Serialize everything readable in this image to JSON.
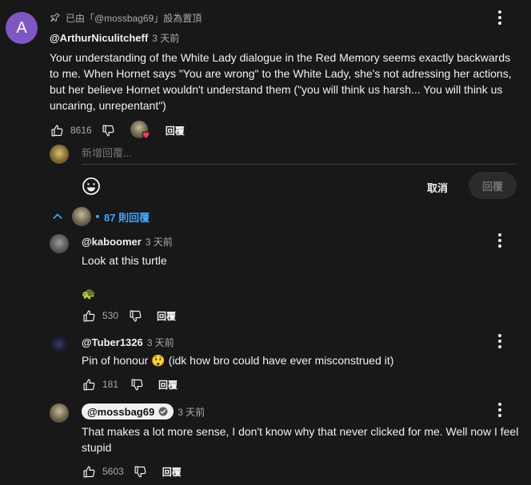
{
  "top_comment": {
    "avatar_letter": "A",
    "pinned_text": "已由「@mossbag69」設為置頂",
    "author": "@ArthurNiculitcheff",
    "time": "3 天前",
    "text": "Your understanding of the White Lady dialogue in the Red Memory seems exactly backwards to me. When Hornet says \"You are wrong\" to the White Lady, she's not adressing her actions, but her believe Hornet wouldn't understand them (\"you will think us harsh... You will think us uncaring, unrepentant\")",
    "likes": "8616",
    "reply_label": "回覆"
  },
  "reply_box": {
    "placeholder": "新增回覆...",
    "cancel_label": "取消",
    "submit_label": "回覆"
  },
  "replies_toggle": {
    "label": "87 則回覆"
  },
  "replies": [
    {
      "author": "@kaboomer",
      "time": "3 天前",
      "text": "Look at this turtle",
      "emoji": "🐢",
      "likes": "530",
      "reply_label": "回覆"
    },
    {
      "author": "@Tuber1326",
      "time": "3 天前",
      "text_before": "Pin of honour",
      "emoji": "😲",
      "text_after": "(idk how bro could have ever misconstrued it)",
      "likes": "181",
      "reply_label": "回覆"
    },
    {
      "author": "@mossbag69",
      "verified_icon": "check-circle-icon",
      "time": "3 天前",
      "text": "That makes a lot more sense, I don't know why that never clicked for me. Well now I feel stupid",
      "likes": "5603",
      "reply_label": "回覆"
    }
  ],
  "colors": {
    "background": "#181818",
    "accent_blue": "#3ea6ff",
    "avatar_purple": "#7e57c2",
    "heart_red": "#ff3b5c"
  }
}
